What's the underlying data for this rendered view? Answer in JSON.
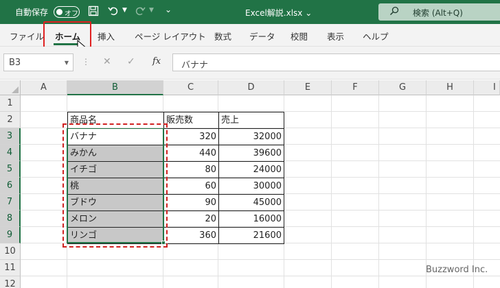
{
  "titlebar": {
    "autosave_label": "自動保存",
    "toggle_state": "オフ",
    "filename": "Excel解説.xlsx",
    "filename_chevron": "chevron-down-icon",
    "search_placeholder": "検索 (Alt+Q)",
    "brand_color": "#217346"
  },
  "ribbon": {
    "tabs": [
      {
        "label": "ファイル"
      },
      {
        "label": "ホーム"
      },
      {
        "label": "挿入"
      },
      {
        "label": "ページ レイアウト"
      },
      {
        "label": "数式"
      },
      {
        "label": "データ"
      },
      {
        "label": "校閲"
      },
      {
        "label": "表示"
      },
      {
        "label": "ヘルプ"
      }
    ],
    "active_tab": "ホーム"
  },
  "formula_bar": {
    "name_box": "B3",
    "fx_label": "fx",
    "content": "バナナ"
  },
  "sheet": {
    "columns": [
      "A",
      "B",
      "C",
      "D",
      "E",
      "F",
      "G",
      "H",
      "I"
    ],
    "rows": [
      "1",
      "2",
      "3",
      "4",
      "5",
      "6",
      "7",
      "8",
      "9",
      "10",
      "11",
      "12"
    ],
    "selected_column": "B",
    "selected_rows": [
      "3",
      "4",
      "5",
      "6",
      "7",
      "8",
      "9"
    ],
    "headers": [
      "商品名",
      "販売数",
      "売上"
    ],
    "data": [
      [
        "バナナ",
        "320",
        "32000"
      ],
      [
        "みかん",
        "440",
        "39600"
      ],
      [
        "イチゴ",
        "80",
        "24000"
      ],
      [
        "桃",
        "60",
        "30000"
      ],
      [
        "ブドウ",
        "90",
        "45000"
      ],
      [
        "メロン",
        "20",
        "16000"
      ],
      [
        "リンゴ",
        "360",
        "21600"
      ]
    ]
  },
  "watermark": "Buzzword Inc."
}
